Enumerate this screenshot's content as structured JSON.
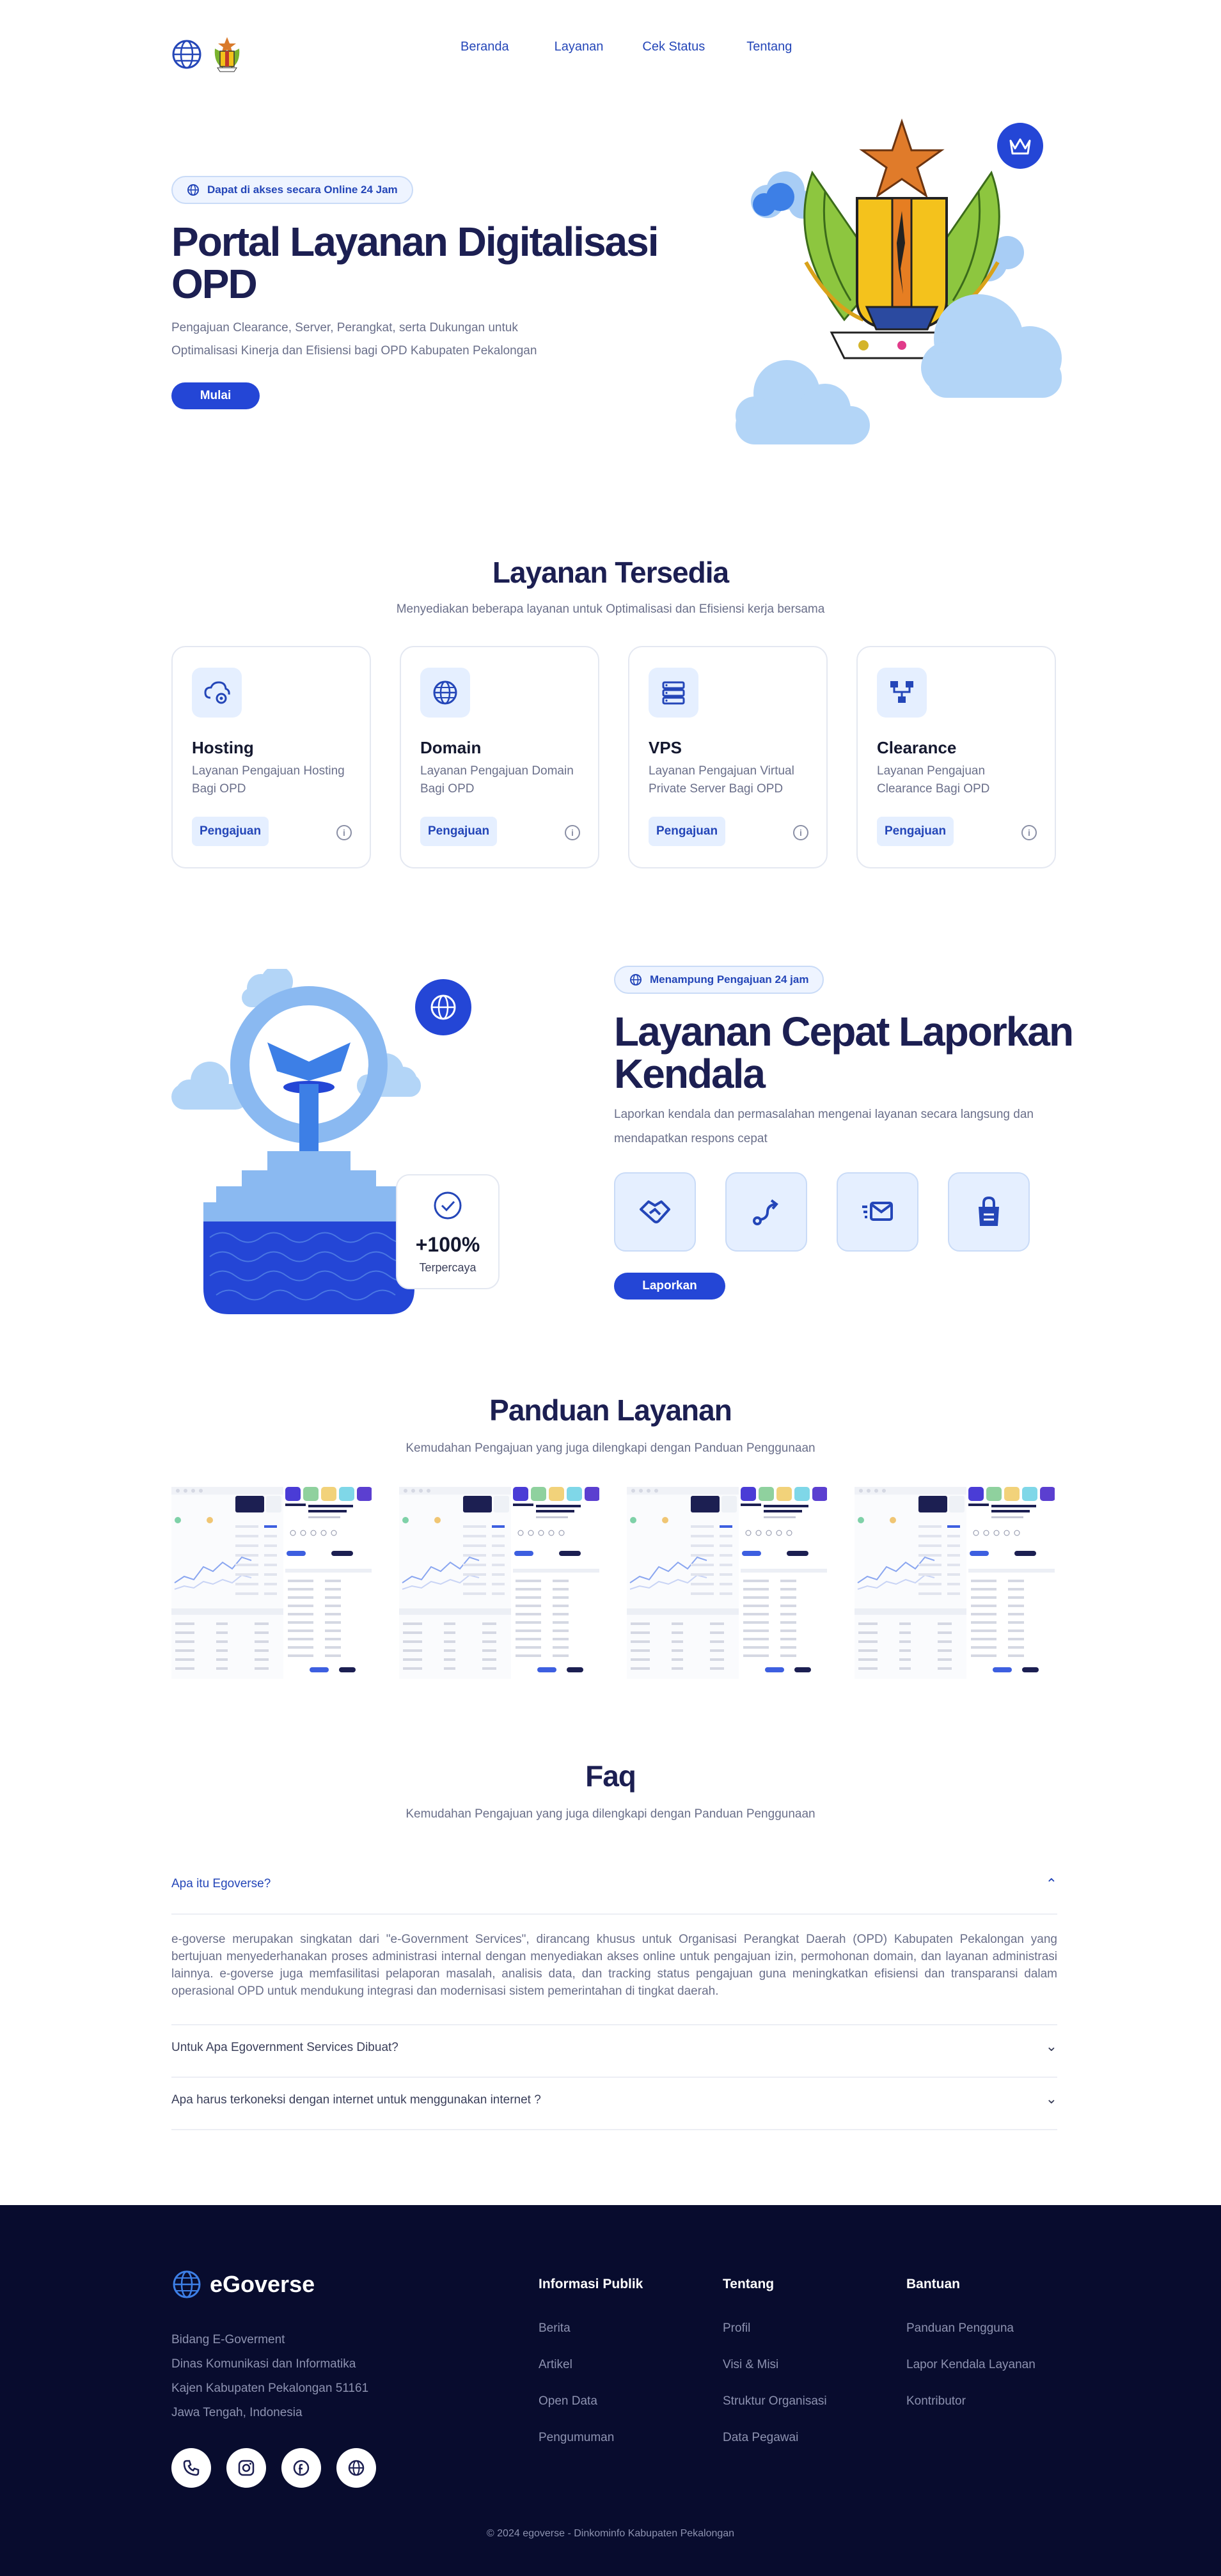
{
  "nav": {
    "items": [
      "Beranda",
      "Layanan",
      "Cek Status",
      "Tentang"
    ]
  },
  "hero": {
    "badge": "Dapat di akses secara Online 24 Jam",
    "title": "Portal Layanan Digitalisasi OPD",
    "subtitle": "Pengajuan Clearance, Server, Perangkat, serta Dukungan untuk Optimalisasi Kinerja dan Efisiensi bagi OPD Kabupaten Pekalongan",
    "button": "Mulai"
  },
  "services": {
    "title": "Layanan Tersedia",
    "subtitle": "Menyediakan beberapa layanan untuk Optimalisasi dan Efisiensi kerja bersama",
    "cards": [
      {
        "icon": "cloud-gear-icon",
        "title": "Hosting",
        "desc": "Layanan Pengajuan Hosting Bagi OPD",
        "button": "Pengajuan"
      },
      {
        "icon": "globe-icon",
        "title": "Domain",
        "desc": "Layanan Pengajuan Domain Bagi OPD",
        "button": "Pengajuan"
      },
      {
        "icon": "server-icon",
        "title": "VPS",
        "desc": "Layanan Pengajuan Virtual Private Server Bagi OPD",
        "button": "Pengajuan"
      },
      {
        "icon": "network-icon",
        "title": "Clearance",
        "desc": "Layanan Pengajuan Clearance Bagi OPD",
        "button": "Pengajuan"
      }
    ]
  },
  "fast": {
    "badge": "Menampung Pengajuan 24 jam",
    "title": "Layanan Cepat Laporkan Kendala",
    "subtitle": "Laporkan kendala dan permasalahan mengenai layanan secara langsung dan mendapatkan respons cepat",
    "stat_value": "+100%",
    "stat_label": "Terpercaya",
    "icons": [
      "handshake-icon",
      "route-icon",
      "fast-mail-icon",
      "shopping-bag-icon"
    ],
    "button": "Laporkan"
  },
  "guide": {
    "title": "Panduan Layanan",
    "subtitle": "Kemudahan Pengajuan yang juga dilengkapi dengan Panduan Penggunaan"
  },
  "faq": {
    "title": "Faq",
    "subtitle": "Kemudahan Pengajuan yang juga dilengkapi dengan Panduan Penggunaan",
    "items": [
      {
        "question": "Apa itu Egoverse?",
        "answer": "e-goverse merupakan singkatan dari \"e-Government Services\", dirancang khusus untuk Organisasi Perangkat Daerah (OPD) Kabupaten Pekalongan yang bertujuan menyederhanakan proses administrasi internal dengan menyediakan akses online untuk pengajuan izin, permohonan domain, dan layanan administrasi lainnya. e-goverse juga memfasilitasi pelaporan masalah, analisis data, dan tracking status pengajuan guna meningkatkan efisiensi dan transparansi dalam operasional OPD untuk mendukung integrasi dan modernisasi sistem pemerintahan di tingkat daerah.",
        "open": true
      },
      {
        "question": "Untuk Apa Egovernment Services Dibuat?",
        "open": false
      },
      {
        "question": "Apa harus terkoneksi dengan internet untuk menggunakan internet ?",
        "open": false
      }
    ]
  },
  "footer": {
    "brand": "eGoverse",
    "address": [
      "Bidang E-Goverment",
      "Dinas Komunikasi dan Informatika",
      "Kajen Kabupaten Pekalongan 51161",
      "Jawa Tengah, Indonesia"
    ],
    "social": [
      "phone-icon",
      "instagram-icon",
      "facebook-icon",
      "globe-icon"
    ],
    "columns": [
      {
        "title": "Informasi Publik",
        "links": [
          "Berita",
          "Artikel",
          "Open Data",
          "Pengumuman"
        ]
      },
      {
        "title": "Tentang",
        "links": [
          "Profil",
          "Visi & Misi",
          "Struktur Organisasi",
          "Data Pegawai"
        ]
      },
      {
        "title": "Bantuan",
        "links": [
          "Panduan Pengguna",
          "Lapor Kendala Layanan",
          "Kontributor"
        ]
      }
    ],
    "copyright": "© 2024 egoverse - Dinkominfo Kabupaten Pekalongan"
  },
  "colors": {
    "primary": "#2446d6",
    "heading": "#1c1f52",
    "light_blue": "#e5efff",
    "footer_bg": "#080c2e"
  }
}
